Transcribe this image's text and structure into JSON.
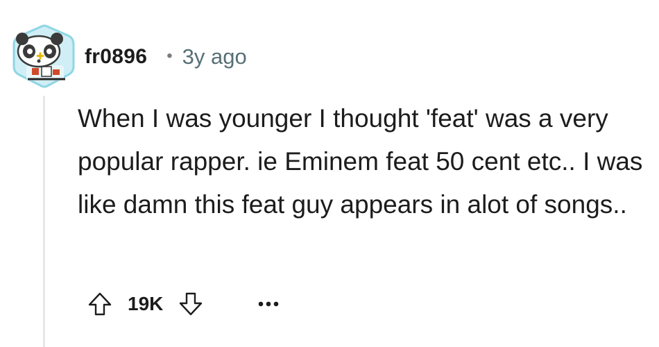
{
  "comment": {
    "author": "fr0896",
    "separator": "•",
    "age": "3y ago",
    "body": "When I was younger I thought 'feat' was a very popular rapper. ie Eminem feat 50 cent etc.. I was like damn this feat guy appears in alot of songs..",
    "vote_count": "19K"
  },
  "icons": {
    "avatar": "panda-gamer-avatar-icon",
    "upvote": "arrow-up-icon",
    "downvote": "arrow-down-icon",
    "more": "more-horizontal-icon"
  },
  "colors": {
    "text": "#1c1c1c",
    "meta": "#576f76",
    "thread_line": "#e4e7ea",
    "avatar_border": "#7fd3e2"
  }
}
